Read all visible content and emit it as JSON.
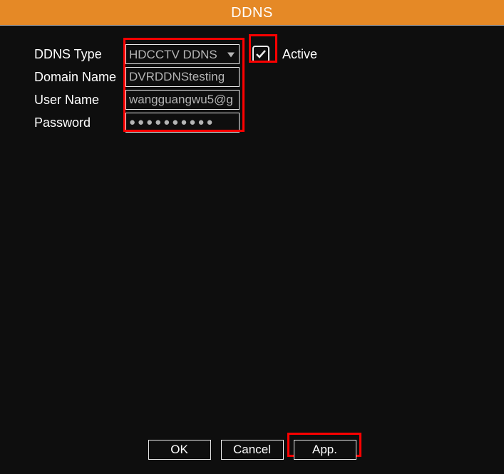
{
  "header": {
    "title": "DDNS"
  },
  "form": {
    "labels": {
      "type": "DDNS Type",
      "domain": "Domain Name",
      "user": "User Name",
      "password": "Password",
      "active": "Active"
    },
    "fields": {
      "type": "HDCCTV DDNS",
      "domain": "DVRDDNStesting",
      "user": "wangguangwu5@g",
      "password_mask": "●●●●●●●●●●"
    },
    "active_checked": true
  },
  "buttons": {
    "ok": "OK",
    "cancel": "Cancel",
    "app": "App."
  }
}
